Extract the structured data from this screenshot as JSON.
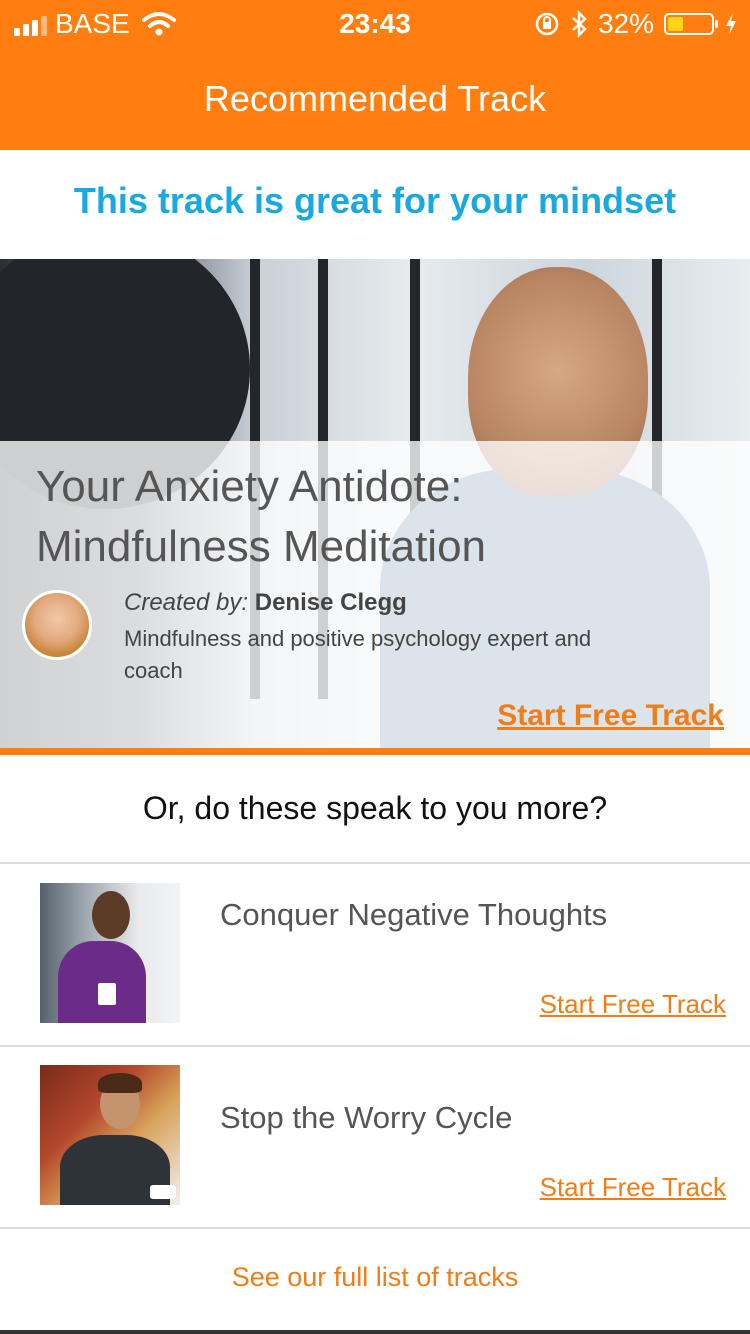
{
  "status_bar": {
    "carrier": "BASE",
    "time": "23:43",
    "battery": "32%",
    "battery_level": 0.32
  },
  "nav": {
    "title": "Recommended Track"
  },
  "headline": "This track is great for your mindset",
  "featured": {
    "title": "Your Anxiety Antidote: Mindfulness Meditation",
    "creator_prefix": "Created by:",
    "creator_name": "Denise Clegg",
    "creator_bio": "Mindfulness and positive psychology expert and coach",
    "cta": "Start Free Track"
  },
  "question": "Or, do these speak to you more?",
  "tracks": [
    {
      "title": "Conquer Negative Thoughts",
      "cta": "Start Free Track"
    },
    {
      "title": "Stop the Worry Cycle",
      "cta": "Start Free Track"
    }
  ],
  "footer_link": "See our full list of tracks",
  "colors": {
    "accent": "#ff7e0f",
    "headline": "#1aa8e0",
    "link": "#f07d16"
  }
}
